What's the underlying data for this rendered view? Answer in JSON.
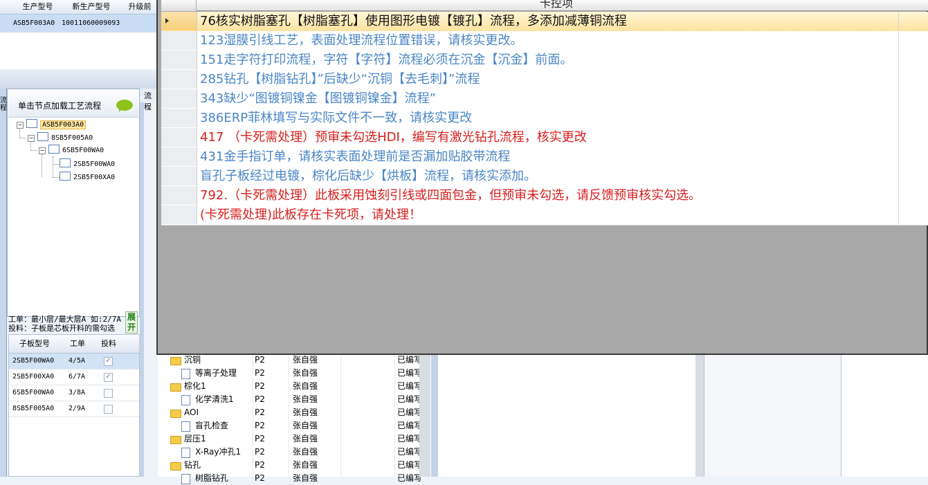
{
  "top_grid": {
    "headers": [
      "生产型号",
      "新生产型号",
      "升级前"
    ],
    "row": [
      "ASB5F003A0",
      "10011060009093"
    ]
  },
  "tree": {
    "title": "单击节点加载工艺流程",
    "nodes": [
      "ASB5F003A0",
      "8SB5F005A0",
      "6SB5F00WA0",
      "2SB5F00WA0",
      "2SB5F00XA0"
    ]
  },
  "info": {
    "line1": "工单：最小层/最大层A 如:2/7A",
    "line2": "投料：子板是芯板开料的需勾选",
    "expand_label": "展开"
  },
  "sub_grid": {
    "headers": [
      "子板型号",
      "工单",
      "投料"
    ],
    "rows": [
      {
        "model": "2SB5F00WA0",
        "order": "4/5A",
        "feed": true
      },
      {
        "model": "2SB5F00XA0",
        "order": "6/7A",
        "feed": true
      },
      {
        "model": "6SB5F00WA0",
        "order": "3/8A",
        "feed": false
      },
      {
        "model": "8SB5F005A0",
        "order": "2/9A",
        "feed": false
      }
    ]
  },
  "left_tab_text": "流程",
  "proc_header_fragment": "流程",
  "process_rows": [
    {
      "name": "沉铜",
      "kind": "folder",
      "p": "P2",
      "person": "张自强",
      "status": "已编写"
    },
    {
      "name": "等离子处理",
      "kind": "doc",
      "p": "P2",
      "person": "张自强",
      "status": "已编写"
    },
    {
      "name": "棕化1",
      "kind": "folder",
      "p": "P2",
      "person": "张自强",
      "status": "已编写"
    },
    {
      "name": "化学清洗1",
      "kind": "doc",
      "p": "P2",
      "person": "张自强",
      "status": "已编写"
    },
    {
      "name": "AOI",
      "kind": "folder",
      "p": "P2",
      "person": "张自强",
      "status": "已编写"
    },
    {
      "name": "盲孔检查",
      "kind": "doc",
      "p": "P2",
      "person": "张自强",
      "status": "已编写"
    },
    {
      "name": "层压1",
      "kind": "folder",
      "p": "P2",
      "person": "张自强",
      "status": "已编写"
    },
    {
      "name": "X-Ray冲孔1",
      "kind": "doc",
      "p": "P2",
      "person": "张自强",
      "status": "已编写"
    },
    {
      "name": "钻孔",
      "kind": "folder",
      "p": "P2",
      "person": "张自强",
      "status": "已编写"
    },
    {
      "name": "树脂钻孔",
      "kind": "doc",
      "p": "P2",
      "person": "张自强",
      "status": "已编写"
    }
  ],
  "popup": {
    "header": "卡控项",
    "colors": {
      "blue": "#4a86c5",
      "red": "#d81e1e",
      "black": "#111111"
    },
    "rows": [
      {
        "text": "76核实树脂塞孔【树脂塞孔】使用图形电镀【镀孔】流程，多添加减薄铜流程",
        "color": "black",
        "selected": true
      },
      {
        "text": "123湿膜引线工艺，表面处理流程位置错误，请核实更改。",
        "color": "blue"
      },
      {
        "text": "151走字符打印流程，字符【字符】流程必须在沉金【沉金】前面。",
        "color": "blue"
      },
      {
        "text": "285钻孔【树脂钻孔】”后缺少“沉铜【去毛刺】”流程",
        "color": "blue"
      },
      {
        "text": "343缺少“图镀铜镍金【图镀铜镍金】流程”",
        "color": "blue"
      },
      {
        "text": "386ERP菲林填写与实际文件不一致，请核实更改",
        "color": "blue"
      },
      {
        "text": "417 （卡死需处理）预审未勾选HDI，编写有激光钻孔流程，核实更改",
        "color": "red"
      },
      {
        "text": "431金手指订单，请核实表面处理前是否漏加贴胶带流程",
        "color": "blue"
      },
      {
        "text": "盲孔子板经过电镀，棕化后缺少【烘板】流程，请核实添加。",
        "color": "blue"
      },
      {
        "text": "792.（卡死需处理）此板采用蚀刻引线或四面包金，但预审未勾选，请反馈预审核实勾选。",
        "color": "red"
      },
      {
        "text": "(卡死需处理)此板存在卡死项，请处理！",
        "color": "red"
      }
    ]
  }
}
